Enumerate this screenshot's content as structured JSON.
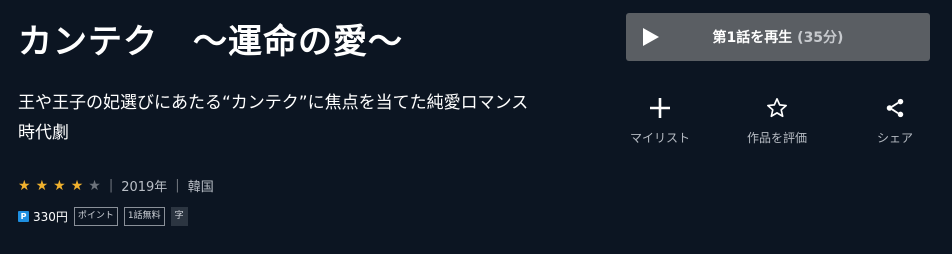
{
  "title": "カンテク　～運命の愛～",
  "description": "王や王子の妃選びにあたる“カンテク”に焦点を当てた純愛ロマンス時代劇",
  "rating": {
    "stars_filled": 4,
    "stars_total": 5
  },
  "meta": {
    "year": "2019年",
    "country": "韓国",
    "separator": "|"
  },
  "price": {
    "icon_text": "P",
    "amount": "330円",
    "tags": [
      "ポイント",
      "1話無料",
      "字"
    ]
  },
  "play_button": {
    "label": "第1話を再生",
    "duration": "(35分)"
  },
  "actions": [
    {
      "icon": "plus-icon",
      "label": "マイリスト"
    },
    {
      "icon": "star-outline-icon",
      "label": "作品を評価"
    },
    {
      "icon": "share-icon",
      "label": "シェア"
    }
  ],
  "colors": {
    "background": "#0c1522",
    "star_on": "#f0b12e",
    "star_off": "#6c727b",
    "play_button_bg": "#5a5e63",
    "point_icon": "#1e8fe0"
  }
}
